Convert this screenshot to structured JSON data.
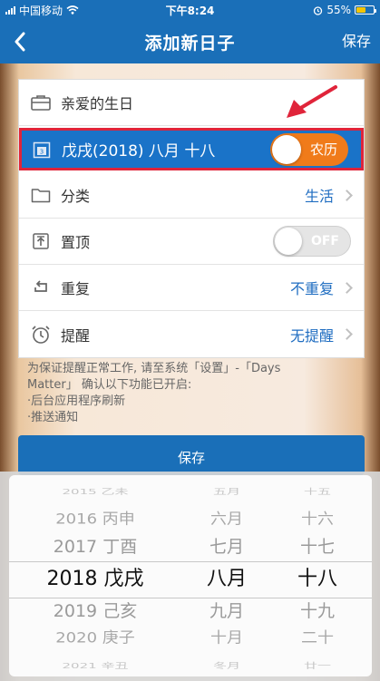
{
  "status": {
    "carrier": "中国移动",
    "time": "下午8:24",
    "battery": "55%"
  },
  "nav": {
    "title": "添加新日子",
    "save": "保存"
  },
  "form": {
    "name_value": "亲爱的生日",
    "date_value": "戊戌(2018) 八月 十八",
    "lunar_toggle": "农历",
    "calendar_icon_digit": "3",
    "category_label": "分类",
    "category_value": "生活",
    "pin_label": "置顶",
    "pin_toggle": "OFF",
    "repeat_label": "重复",
    "repeat_value": "不重复",
    "reminder_label": "提醒",
    "reminder_value": "无提醒"
  },
  "note": {
    "line1": "为保证提醒正常工作, 请至系统「设置」-「Days",
    "line2": "Matter」 确认以下功能已开启:",
    "line3": "·后台应用程序刷新",
    "line4": "·推送通知"
  },
  "save_button": "保存",
  "picker": {
    "years": [
      "2015 乙未",
      "2016 丙申",
      "2017 丁酉",
      "2018 戊戌",
      "2019 己亥",
      "2020 庚子",
      "2021 辛丑"
    ],
    "months": [
      "五月",
      "六月",
      "七月",
      "八月",
      "九月",
      "十月",
      "冬月"
    ],
    "days": [
      "十五",
      "十六",
      "十七",
      "十八",
      "十九",
      "二十",
      "廿一"
    ],
    "selected_index": 3
  },
  "colors": {
    "brand_blue": "#1a6fb8",
    "accent_orange": "#f07b1a",
    "highlight_red": "#e0243a"
  }
}
